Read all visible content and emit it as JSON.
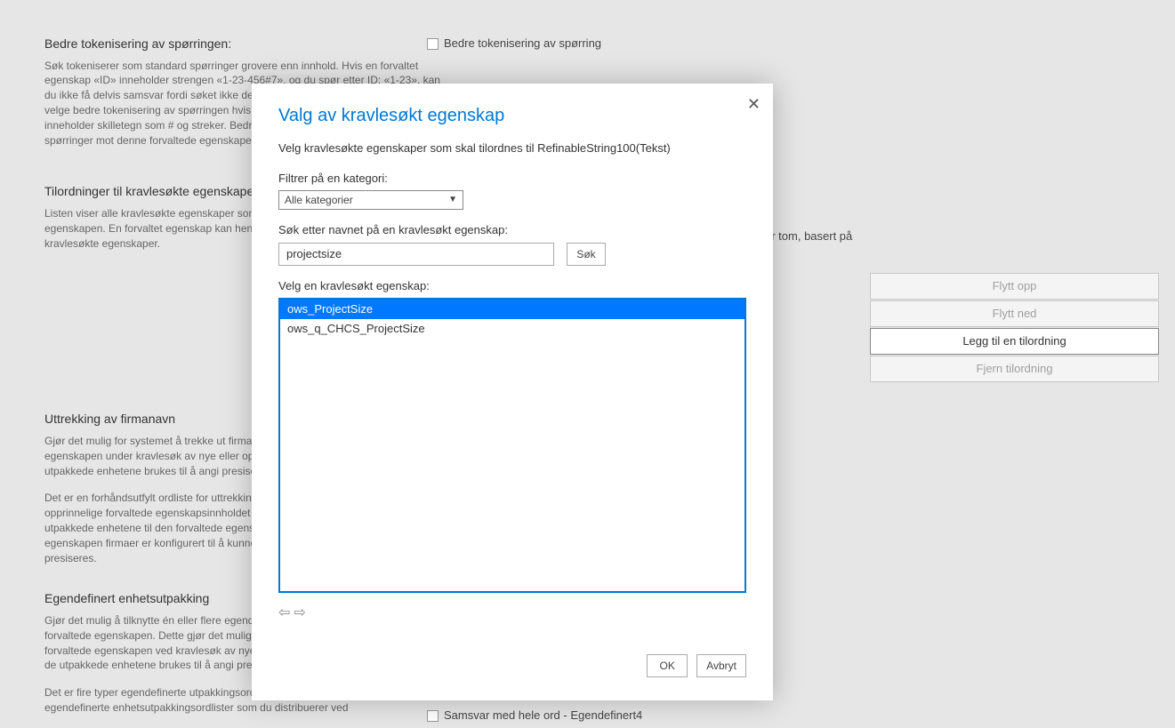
{
  "bg": {
    "sec1": {
      "title": "Bedre tokenisering av spørringen:",
      "body": "Søk tokeniserer som standard spørringer grovere enn innhold. Hvis en forvaltet egenskap «ID» inneholder strengen «1-23-456#7», og du spør etter ID: «1-23», kan du ikke få delvis samsvar fordi søket ikke deler spørringen i små nok deler. Vurder å velge bedre tokenisering av spørringen hvis innholdet i denne forvaltede egenskapen inneholder skilletegn som # og streker. Bedre tokenisering av spørringen gjør spørringer mot denne forvaltede egenskapen tregere."
    },
    "sec2": {
      "title": "Tilordninger til kravlesøkte egenskaper",
      "body": "Listen viser alle kravlesøkte egenskaper som er tilordnet denne forvaltede egenskapen. En forvaltet egenskap kan hente innholdet sitt fra én eller flere kravlesøkte egenskaper."
    },
    "sec3": {
      "title": "Uttrekking av firmanavn",
      "body1": "Gjør det mulig for systemet å trekke ut firmanavnenheter fra den forvaltede egenskapen under kravlesøk av nye eller oppdaterte elementer. Etterpå kan de utpakkede enhetene brukes til å angi presiseringer i webdelen.",
      "body2": "Det er en forhåndsutfylt ordliste for uttrekking av firmanavn. Systemet lagrer det opprinnelige forvaltede egenskapsinnholdet uendret i indeksen, og i tillegg kopierer de utpakkede enhetene til den forvaltede egenskapen firmaer. Den forvaltede egenskapen firmaer er konfigurert til å kunne søkes, spørres, hentes, sorteres og presiseres."
    },
    "sec4": {
      "title": "Egendefinert enhetsutpakking",
      "body1": "Gjør det mulig å tilknytte én eller flere egendefinerte enhetsutpakkinger med denne forvaltede egenskapen. Dette gjør det mulig for systemet å trekke ut enheter fra den forvaltede egenskapen ved kravlesøk av nye eller oppdaterte elementer. Etterpå kan de utpakkede enhetene brukes til å angi presiseringer i webdelen.",
      "body2": "Det er fire typer egendefinerte utpakkingsordlister. Du oppretter egne, separate egendefinerte enhetsutpakkingsordlister som du distribuerer ved"
    }
  },
  "right": {
    "chk_tokenize": "Bedre tokenisering av spørring",
    "truncated_text": "er tom, basert på",
    "btns": {
      "up": "Flytt opp",
      "down": "Flytt ned",
      "add": "Legg til en tilordning",
      "remove": "Fjern tilordning"
    },
    "chk_wholeword": "Samsvar med hele ord - Egendefinert4"
  },
  "modal": {
    "title": "Valg av kravlesøkt egenskap",
    "instruction": "Velg kravlesøkte egenskaper som skal tilordnes til RefinableString100(Tekst)",
    "filter_label": "Filtrer på en kategori:",
    "filter_value": "Alle kategorier",
    "search_label": "Søk etter navnet på en kravlesøkt egenskap:",
    "search_value": "projectsize",
    "search_btn": "Søk",
    "list_label": "Velg en kravlesøkt egenskap:",
    "items": [
      "ows_ProjectSize",
      "ows_q_CHCS_ProjectSize"
    ],
    "ok": "OK",
    "cancel": "Avbryt"
  }
}
